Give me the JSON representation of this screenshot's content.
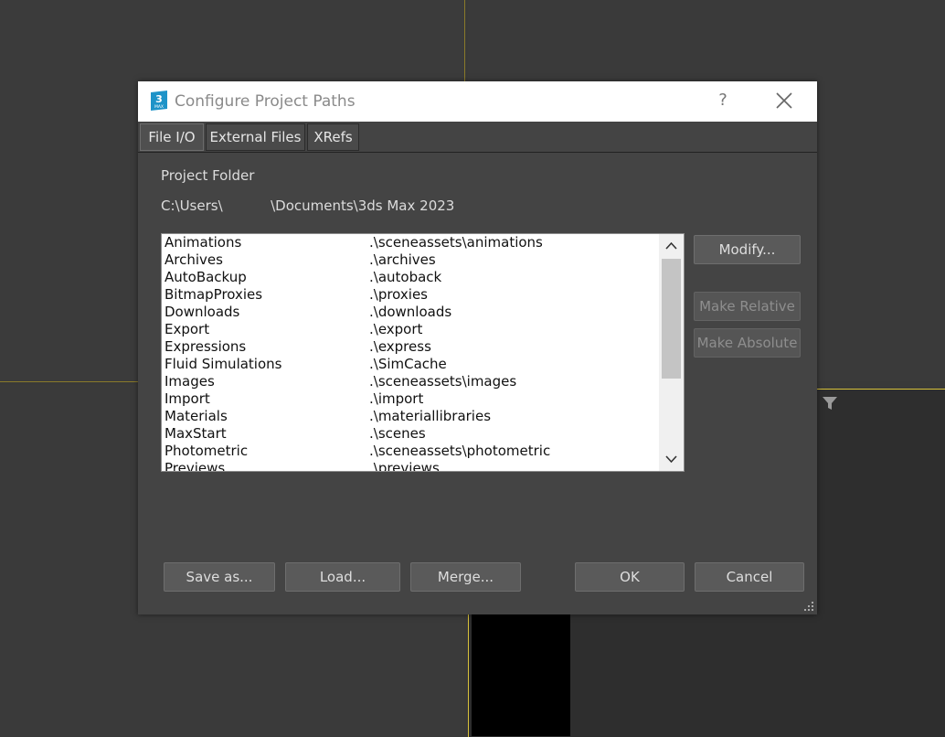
{
  "dialog": {
    "title": "Configure Project Paths",
    "help": "?",
    "tabs": [
      "File I/O",
      "External Files",
      "XRefs"
    ],
    "project_folder_label": "Project Folder",
    "project_folder_path": "C:\\Users\\           \\Documents\\3ds Max 2023",
    "paths": [
      {
        "name": "Animations",
        "path": ".\\sceneassets\\animations"
      },
      {
        "name": "Archives",
        "path": ".\\archives"
      },
      {
        "name": "AutoBackup",
        "path": ".\\autoback"
      },
      {
        "name": "BitmapProxies",
        "path": ".\\proxies"
      },
      {
        "name": "Downloads",
        "path": ".\\downloads"
      },
      {
        "name": "Export",
        "path": ".\\export"
      },
      {
        "name": "Expressions",
        "path": ".\\express"
      },
      {
        "name": "Fluid Simulations",
        "path": ".\\SimCache"
      },
      {
        "name": "Images",
        "path": ".\\sceneassets\\images"
      },
      {
        "name": "Import",
        "path": ".\\import"
      },
      {
        "name": "Materials",
        "path": ".\\materiallibraries"
      },
      {
        "name": "MaxStart",
        "path": ".\\scenes"
      },
      {
        "name": "Photometric",
        "path": ".\\sceneassets\\photometric"
      },
      {
        "name": "Previews",
        "path": ".\\previews"
      }
    ],
    "buttons": {
      "modify": "Modify...",
      "make_relative": "Make Relative",
      "make_absolute": "Make Absolute",
      "save_as": "Save as...",
      "load": "Load...",
      "merge": "Merge...",
      "ok": "OK",
      "cancel": "Cancel"
    }
  },
  "colors": {
    "dialog_bg": "#444444",
    "viewport_active_border": "#d8c23a",
    "app_icon": "#1e93c8"
  },
  "icons": [
    "app-3dsmax-icon",
    "help-icon",
    "close-icon",
    "scroll-up-icon",
    "scroll-down-icon",
    "filter-icon",
    "resize-grip-icon"
  ]
}
